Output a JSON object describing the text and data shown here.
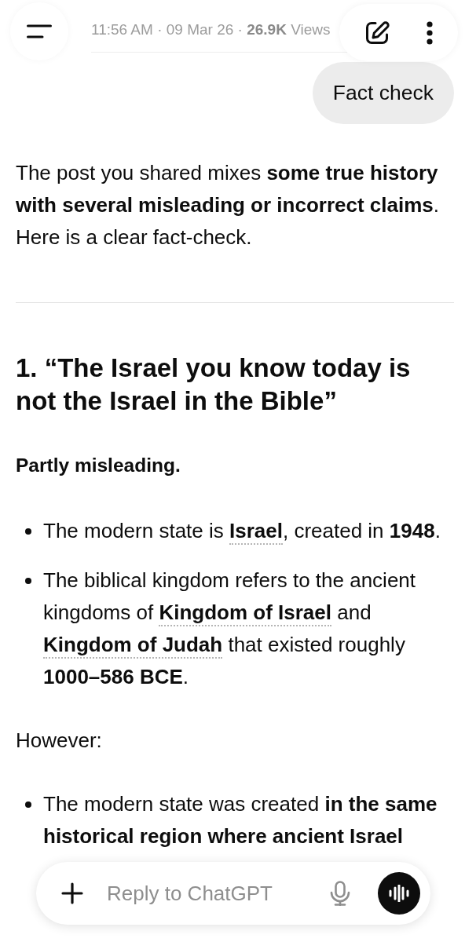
{
  "header": {
    "post_meta": "11:56 AM · 09 Mar 26 · **26.9K** Views"
  },
  "user_message": {
    "text": "Fact check"
  },
  "response": [
    {
      "kind": "paragraph",
      "segments": [
        {
          "kind": "text",
          "text": "The post you shared mixes **some true history with several misleading or incorrect claims**. Here is a clear fact-check."
        }
      ]
    },
    {
      "kind": "divider"
    },
    {
      "kind": "heading",
      "text": "1. “The Israel you know today is not the Israel in the Bible”"
    },
    {
      "kind": "verdict",
      "text": "Partly misleading."
    },
    {
      "kind": "bullets",
      "items": [
        {
          "segments": [
            {
              "kind": "text",
              "text": "The modern state is "
            },
            {
              "kind": "entity",
              "text": "Israel"
            },
            {
              "kind": "text",
              "text": ", created in **1948**."
            }
          ]
        },
        {
          "segments": [
            {
              "kind": "text",
              "text": "The biblical kingdom refers to the ancient kingdoms of "
            },
            {
              "kind": "entity",
              "text": "Kingdom of Israel"
            },
            {
              "kind": "text",
              "text": " and "
            },
            {
              "kind": "entity",
              "text": "Kingdom of Judah"
            },
            {
              "kind": "text",
              "text": " that existed roughly **1000–586 BCE**."
            }
          ]
        }
      ]
    },
    {
      "kind": "paragraph",
      "segments": [
        {
          "kind": "text",
          "text": "However:"
        }
      ]
    },
    {
      "kind": "bullets",
      "items": [
        {
          "segments": [
            {
              "kind": "text",
              "text": "The modern state was created **in the same historical region where ancient Israel**"
            }
          ]
        }
      ]
    }
  ],
  "composer": {
    "placeholder": "Reply to ChatGPT"
  }
}
